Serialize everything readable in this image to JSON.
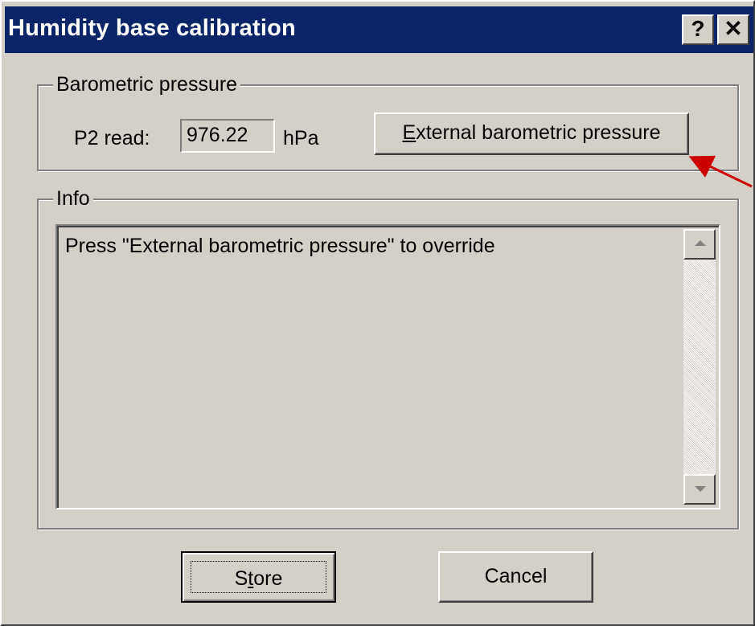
{
  "window": {
    "title": "Humidity base calibration",
    "help_glyph": "?",
    "close_glyph": "✕"
  },
  "barometric": {
    "group_label": "Barometric pressure",
    "p2_label": "P2 read:",
    "p2_value": "976.22",
    "unit": "hPa",
    "external_button": {
      "mnemonic": "E",
      "rest": "xternal barometric pressure"
    }
  },
  "info": {
    "group_label": "Info",
    "text": "Press \"External barometric pressure\" to override"
  },
  "buttons": {
    "store": {
      "mnemonic_before": "S",
      "mnemonic": "t",
      "rest": "ore"
    },
    "cancel": "Cancel"
  },
  "annotation": {
    "arrow_color": "#cc0000"
  }
}
